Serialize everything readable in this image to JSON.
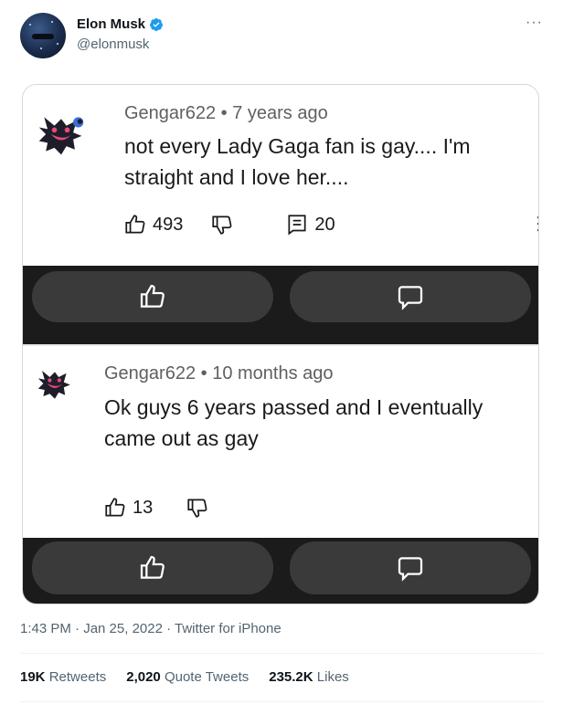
{
  "author": {
    "name": "Elon Musk",
    "handle": "@elonmusk",
    "avatar_icon": "avatar-image",
    "verified_icon": "verified-badge-icon",
    "verified_color": "#1d9bf0"
  },
  "menu_icon": "more-icon",
  "media": {
    "comments": [
      {
        "author": "Gengar622",
        "age": "7 years ago",
        "text": "not every Lady Gaga fan is gay.... I'm straight and I love her....",
        "likes": "493",
        "replies": "20"
      },
      {
        "author": "Gengar622",
        "age": "10 months ago",
        "text": "Ok guys 6 years passed and I eventually came out as gay",
        "likes": "13"
      }
    ]
  },
  "timestamp": "1:43 PM · Jan 25, 2022 · Twitter for iPhone",
  "stats": {
    "retweets_count": "19K",
    "retweets_label": "Retweets",
    "quotes_count": "2,020",
    "quotes_label": "Quote Tweets",
    "likes_count": "235.2K",
    "likes_label": "Likes"
  }
}
